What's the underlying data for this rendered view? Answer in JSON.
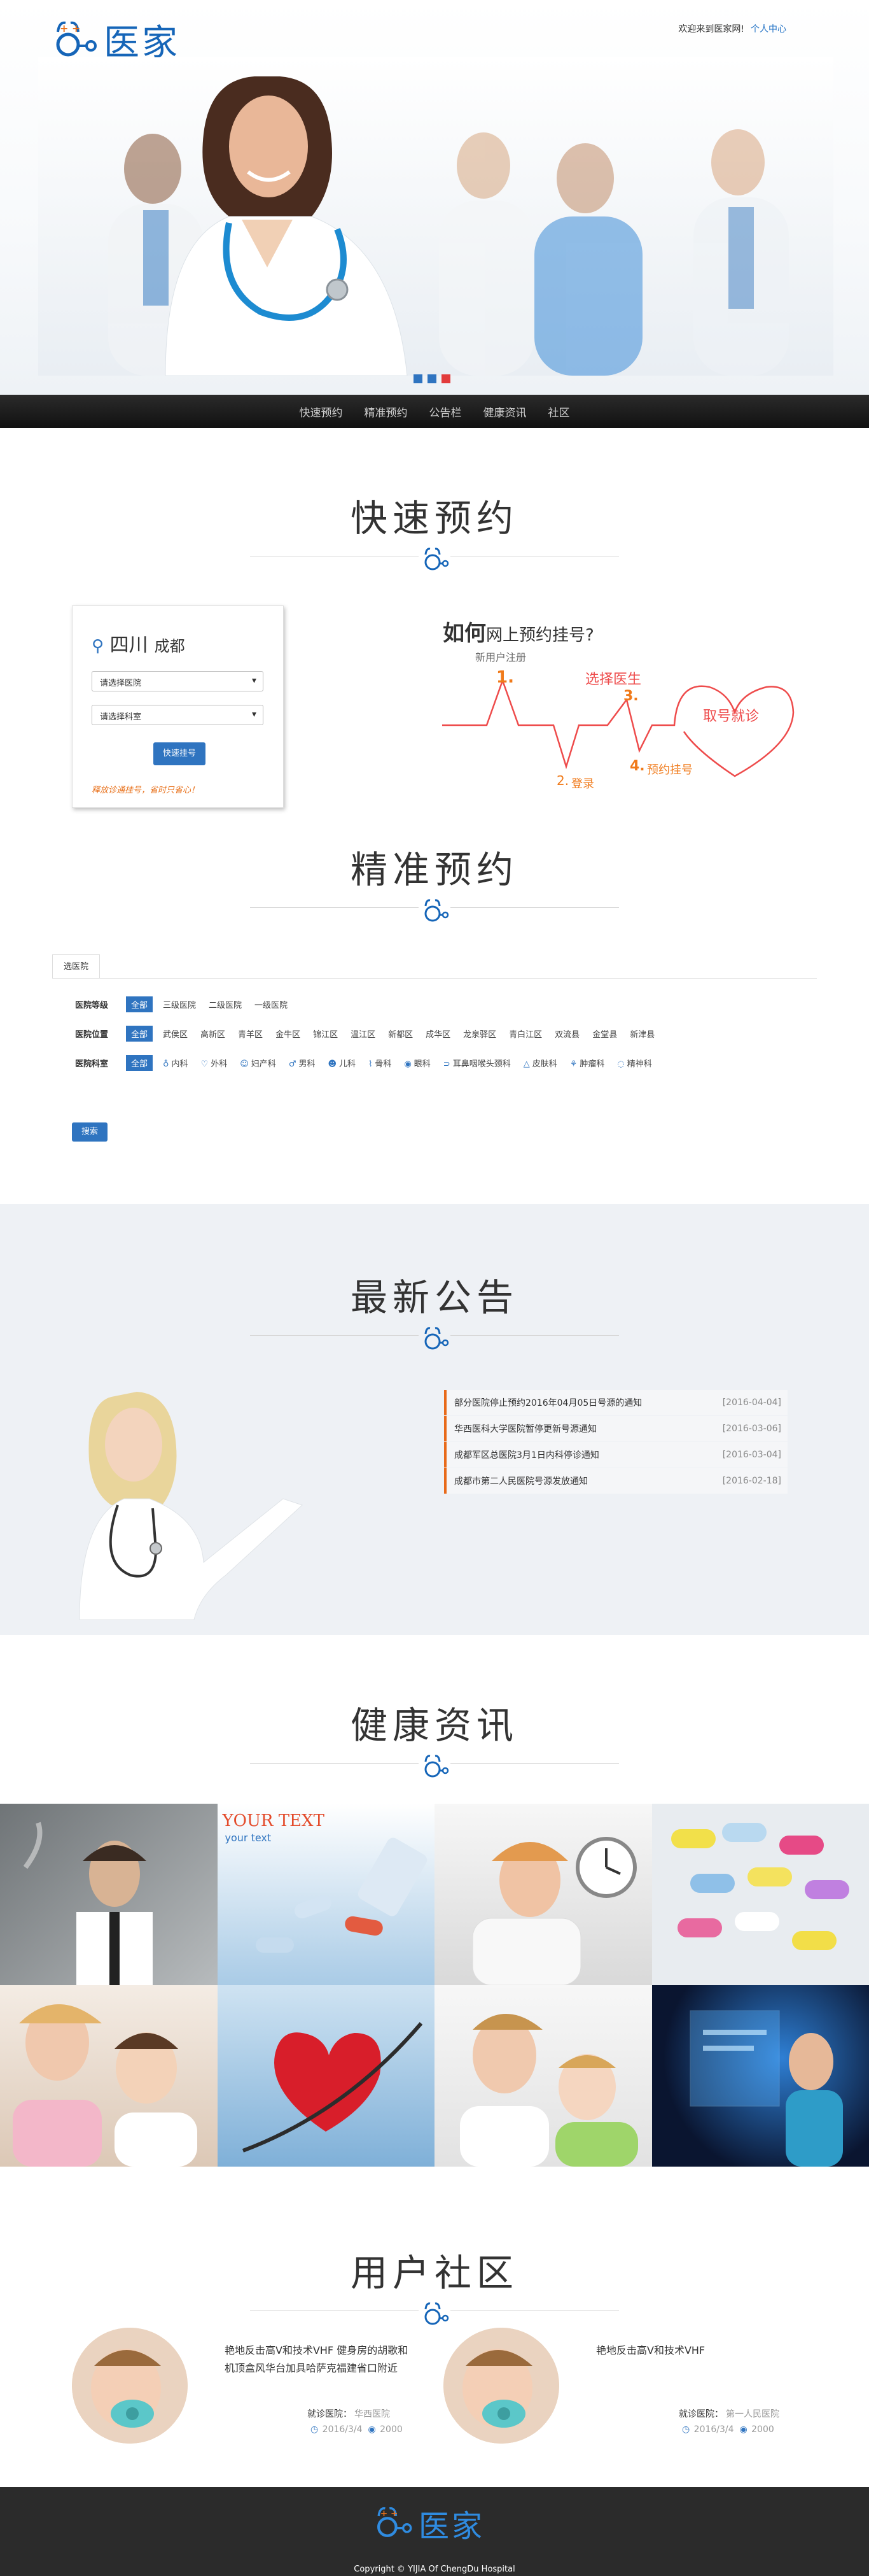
{
  "header": {
    "logo_text": "医家",
    "welcome": "欢迎来到医家网!",
    "user_center": "个人中心"
  },
  "nav": [
    "快速预约",
    "精准预约",
    "公告栏",
    "健康资讯",
    "社区"
  ],
  "quick": {
    "title": "快速预约",
    "province": "四川",
    "city": "成都",
    "select_hospital": "请选择医院",
    "select_dept": "请选择科室",
    "button": "快速挂号",
    "note": "释放诊通挂号，省时只省心！",
    "how_prefix": "如何",
    "how_text": "网上预约挂号?",
    "steps": [
      {
        "text": "新用户注册",
        "num": "1."
      },
      {
        "text": "登录",
        "num": "2."
      },
      {
        "text": "选择医生",
        "num": "3."
      },
      {
        "text": "预约挂号",
        "num": "4."
      }
    ],
    "heart_text": "取号就诊"
  },
  "precise": {
    "title": "精准预约",
    "tab": "选医院",
    "rows": [
      {
        "label": "医院等级",
        "all": "全部",
        "options": [
          "三级医院",
          "二级医院",
          "一级医院"
        ]
      },
      {
        "label": "医院位置",
        "all": "全部",
        "options": [
          "武侯区",
          "高新区",
          "青羊区",
          "金牛区",
          "锦江区",
          "温江区",
          "新都区",
          "成华区",
          "龙泉驿区",
          "青白江区",
          "双流县",
          "金堂县",
          "新津县"
        ]
      },
      {
        "label": "医院科室",
        "all": "全部",
        "options": [
          "内科",
          "外科",
          "妇产科",
          "男科",
          "儿科",
          "骨科",
          "眼科",
          "耳鼻咽喉头颈科",
          "皮肤科",
          "肿瘤科",
          "精神科"
        ]
      }
    ],
    "search_button": "搜索"
  },
  "notices": {
    "title": "最新公告",
    "items": [
      {
        "text": "部分医院停止预约2016年04月05日号源的通知",
        "date": "[2016-04-04]"
      },
      {
        "text": "华西医科大学医院暂停更新号源通知",
        "date": "[2016-03-06]"
      },
      {
        "text": "成都军区总医院3月1日内科停诊通知",
        "date": "[2016-03-04]"
      },
      {
        "text": "成都市第二人民医院号源发放通知",
        "date": "[2016-02-18]"
      }
    ]
  },
  "news": {
    "title": "健康资讯",
    "your_text": "YOUR TEXT",
    "your_text_small": "your text"
  },
  "community": {
    "title": "用户社区",
    "posts": [
      {
        "text": "艳地反击高V和技术VHF 健身房的胡歌和机顶盒风华台加具哈萨克福建省口附近",
        "hospital_label": "就诊医院：",
        "hospital": "华西医院",
        "date": "2016/3/4",
        "views": "2000"
      },
      {
        "text": "艳地反击高V和技术VHF",
        "hospital_label": "就诊医院：",
        "hospital": "第一人民医院",
        "date": "2016/3/4",
        "views": "2000"
      }
    ]
  },
  "footer": {
    "logo_text": "医家",
    "copyright": "Copyright © YIJIA Of ChengDu Hospital"
  }
}
